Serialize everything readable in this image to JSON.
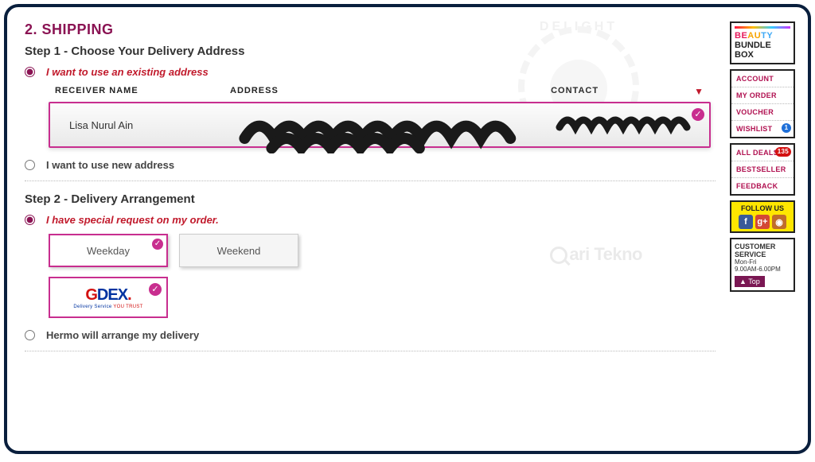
{
  "section_title": "2. SHIPPING",
  "watermark": {
    "delight": "DELIGHT",
    "brand": "ari Tekno"
  },
  "step1": {
    "title": "Step 1 - Choose Your Delivery Address",
    "option_existing": "I want to use an existing address",
    "option_new": "I want to use new address",
    "headers": {
      "receiver": "RECEIVER NAME",
      "address": "ADDRESS",
      "contact": "CONTACT"
    },
    "row": {
      "receiver": "Lisa Nurul Ain"
    }
  },
  "step2": {
    "title": "Step 2 - Delivery Arrangement",
    "option_special": "I have special request on my order.",
    "option_auto": "Hermo will arrange my delivery",
    "weekday": "Weekday",
    "weekend": "Weekend",
    "courier": {
      "name_g": "G",
      "name_d": "D",
      "name_ex": "EX",
      "dot": ".",
      "tag_pre": "Delivery Service ",
      "tag_em": "YOU TRUST"
    }
  },
  "sidebar": {
    "promo": {
      "l1_be": "BE",
      "l1_au": "AU",
      "l1_ty": "TY",
      "l2": "BUNDLE",
      "l3": "BOX"
    },
    "account_items": [
      {
        "label": "ACCOUNT"
      },
      {
        "label": "MY ORDER"
      },
      {
        "label": "VOUCHER"
      },
      {
        "label": "WISHLIST",
        "badge": "1",
        "badge_blue": true
      }
    ],
    "deals_items": [
      {
        "label": "ALL DEALS",
        "badge": "135"
      },
      {
        "label": "BESTSELLER"
      },
      {
        "label": "FEEDBACK"
      }
    ],
    "follow": "FOLLOW US",
    "cs": {
      "h1": "CUSTOMER",
      "h2": "SERVICE",
      "days": "Mon-Fri",
      "hours": "9.00AM-6.00PM"
    },
    "top": "▲ Top"
  }
}
